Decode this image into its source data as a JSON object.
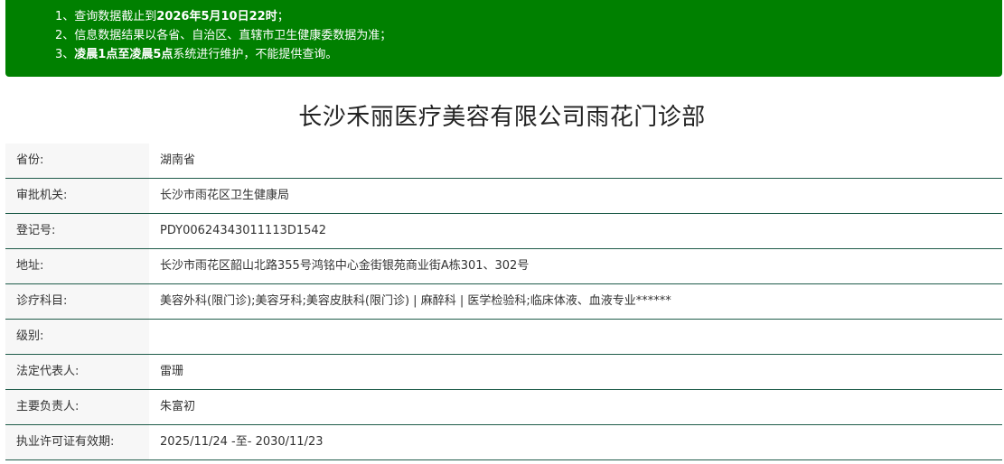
{
  "notice": {
    "bg_color": "#008000",
    "lines": [
      {
        "parts": [
          {
            "text": "1、查询数据截止到",
            "bold": false
          },
          {
            "text": "2026年5月10日22时",
            "bold": true
          },
          {
            "text": "；",
            "bold": false
          }
        ]
      },
      {
        "parts": [
          {
            "text": "2、信息数据结果以各省、自治区、直辖市卫生健康委数据为准；",
            "bold": false
          }
        ]
      },
      {
        "parts": [
          {
            "text": "3、",
            "bold": false
          },
          {
            "text": "凌晨1点至凌晨5点",
            "bold": true
          },
          {
            "text": "系统进行维护，不能提供查询。",
            "bold": false
          }
        ]
      }
    ]
  },
  "page": {
    "title": "长沙禾丽医疗美容有限公司雨花门诊部"
  },
  "details": [
    {
      "key": "province",
      "label": "省份:",
      "value": "湖南省"
    },
    {
      "key": "approval-authority",
      "label": "审批机关:",
      "value": "长沙市雨花区卫生健康局"
    },
    {
      "key": "registration-number",
      "label": "登记号:",
      "value": "PDY00624343011113D1542"
    },
    {
      "key": "address",
      "label": "地址:",
      "value": "长沙市雨花区韶山北路355号鸿铭中心金街银苑商业街A栋301、302号"
    },
    {
      "key": "departments",
      "label": "诊疗科目:",
      "value": "美容外科(限门诊);美容牙科;美容皮肤科(限门诊) | 麻醉科 | 医学检验科;临床体液、血液专业******"
    },
    {
      "key": "level",
      "label": "级别:",
      "value": ""
    },
    {
      "key": "legal-representative",
      "label": "法定代表人:",
      "value": "雷珊"
    },
    {
      "key": "principal",
      "label": "主要负责人:",
      "value": "朱富初"
    },
    {
      "key": "license-validity",
      "label": "执业许可证有效期:",
      "value": "2025/11/24 -至- 2030/11/23"
    }
  ],
  "colors": {
    "row_border": "#1f5c4a",
    "label_bg": "#f7f7f7"
  }
}
